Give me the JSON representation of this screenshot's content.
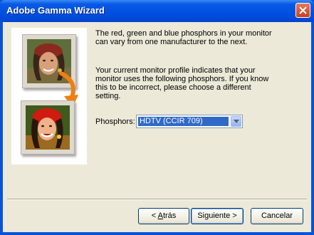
{
  "window": {
    "title": "Adobe Gamma Wizard"
  },
  "content": {
    "paragraph1_line1": "The red, green and blue phosphors in your monitor",
    "paragraph1_line2": "can vary from one manufacturer to the next.",
    "paragraph2_line1": "Your current monitor profile indicates that your",
    "paragraph2_line2": "monitor uses the following phosphors. If you know",
    "paragraph2_line3": "this to be incorrect, please choose a different",
    "paragraph2_line4": "setting.",
    "phosphors_label": "Phosphors:",
    "phosphors_value": "HDTV (CCIR 709)"
  },
  "buttons": {
    "back_pre": "< ",
    "back_hotkey": "A",
    "back_post": "trás",
    "next_pre": "Siguiente ",
    "next_post": ">",
    "cancel": "Cancelar"
  },
  "icons": {
    "close": "close-icon",
    "dropdown": "chevron-down-icon",
    "arrow": "curved-arrow-icon"
  },
  "colors": {
    "titlebar": "#0054e3",
    "selection": "#316ac5",
    "arrow": "#f07f10"
  }
}
